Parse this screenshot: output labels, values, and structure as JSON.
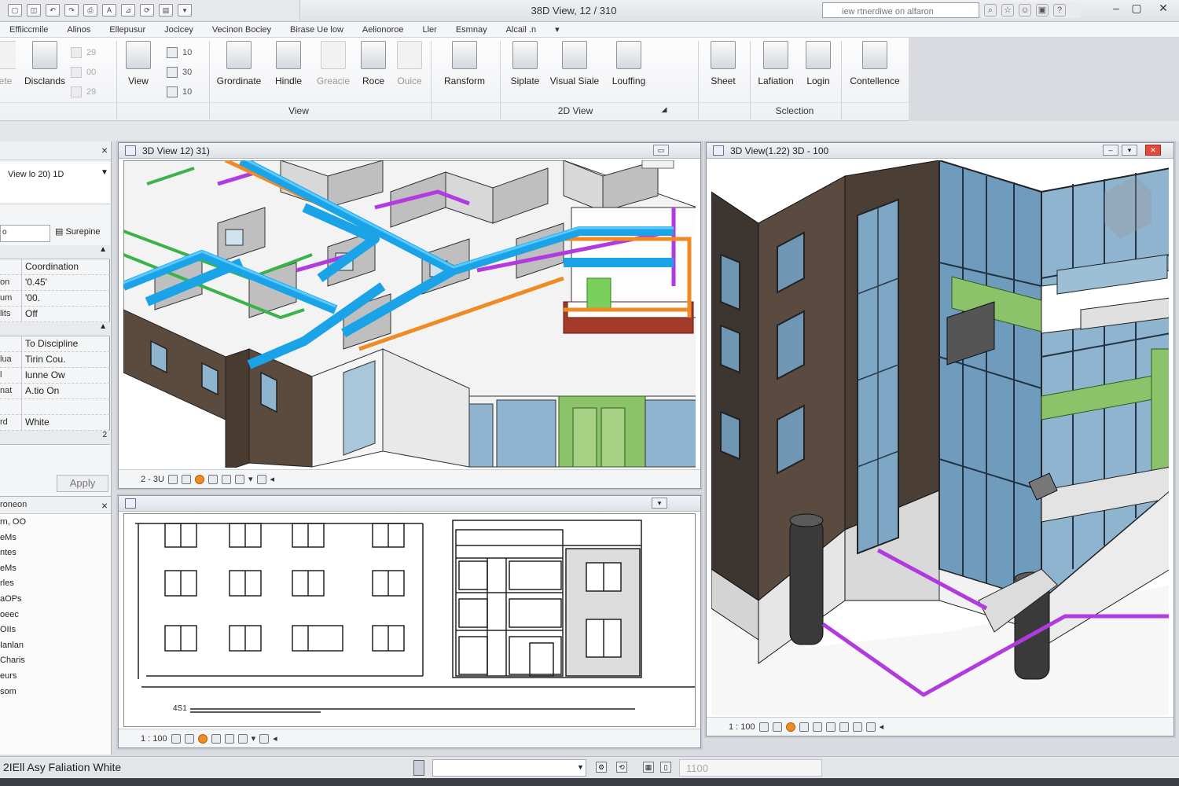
{
  "titlebar": {
    "title": "38D View, 12 / 310",
    "search_placeholder": "iew rtnerdiwe on alfaron",
    "qat_icons": [
      "open-icon",
      "save-icon",
      "undo-icon",
      "redo-icon",
      "print-icon",
      "text-icon",
      "measure-icon",
      "sync-icon",
      "switch-windows-icon",
      "dropdown-icon"
    ],
    "tools": [
      "search-icon",
      "infocenter-icon",
      "favorites-icon",
      "sign-in-icon",
      "help-icon"
    ]
  },
  "menu": {
    "tabs": [
      "Effiiccmile",
      "Alinos",
      "Ellepusur",
      "Jocicey",
      "Vecinon Bociey",
      "Birase Ue low",
      "Aelionoroe",
      "Ller",
      "Esmnay",
      "Alcail .n"
    ]
  },
  "ribbon": {
    "buttons": [
      {
        "id": "ete",
        "label": "ete"
      },
      {
        "id": "disclands",
        "label": "Disclands"
      },
      {
        "id": "view",
        "label": "View"
      },
      {
        "id": "grordinate",
        "label": "Grordinate"
      },
      {
        "id": "hindle",
        "label": "Hindle"
      },
      {
        "id": "greacie",
        "label": "Greacie"
      },
      {
        "id": "roce",
        "label": "Roce"
      },
      {
        "id": "ouice",
        "label": "Ouice"
      },
      {
        "id": "ransform",
        "label": "Ransform"
      },
      {
        "id": "siplate",
        "label": "Siplate"
      },
      {
        "id": "visual-siale",
        "label": "Visual Siale"
      },
      {
        "id": "louffing",
        "label": "Louffing"
      },
      {
        "id": "sheet",
        "label": "Sheet"
      },
      {
        "id": "lafiation",
        "label": "Lafiation"
      },
      {
        "id": "login",
        "label": "Login"
      },
      {
        "id": "contellence",
        "label": "Contellence"
      }
    ],
    "stack_a": [
      "29",
      "00",
      "29"
    ],
    "stack_b": [
      "10",
      "30",
      "10"
    ],
    "panels": {
      "view": "View",
      "view2d": "2D View",
      "selection": "Sclection"
    }
  },
  "properties": {
    "type_selector": "View lo 20) 1D",
    "filter_value": "o",
    "edit_type": "Surepine",
    "rows": [
      {
        "k": "",
        "v": "Coordination"
      },
      {
        "k": "on",
        "v": "'0.45'"
      },
      {
        "k": "um",
        "v": "'00."
      },
      {
        "k": "lits",
        "v": "Off"
      },
      {
        "group": true
      },
      {
        "k": "",
        "v": "To Discipline"
      },
      {
        "k": "lua",
        "v": "Tirin Cou."
      },
      {
        "k": "l",
        "v": "lunne Ow"
      },
      {
        "k": "nat",
        "v": "A.tio On"
      },
      {
        "k": "",
        "v": ""
      },
      {
        "k": "rd",
        "v": "White"
      }
    ],
    "apply_label": "Apply"
  },
  "browser": {
    "title": "roneon",
    "items": [
      "rn, OO",
      "eMs",
      "ntes",
      "eMs",
      "rles",
      "aOPs",
      "oeec",
      "OIIs",
      "Ianlan",
      "Charis",
      "eurs",
      "som"
    ]
  },
  "views": {
    "top_left": {
      "title": "3D View 12) 31)",
      "scale": "2 - 3U"
    },
    "right": {
      "title": "3D View(1.22) 3D - 100",
      "scale": "1 : 100"
    },
    "bottom_left": {
      "title": "",
      "scale": "1 : 100",
      "annotation": "4S1"
    }
  },
  "status": {
    "text": "2IEll Asy Faliation White",
    "scale_value": "1100"
  },
  "colors": {
    "duct_blue": "#1aa3e6",
    "pipe_purple": "#b23be0",
    "pipe_orange": "#f08a24",
    "pipe_green": "#3cb34a",
    "glazing": "#8fb4cf",
    "brick": "#5b4a3e",
    "accent_green": "#8cc26a"
  }
}
